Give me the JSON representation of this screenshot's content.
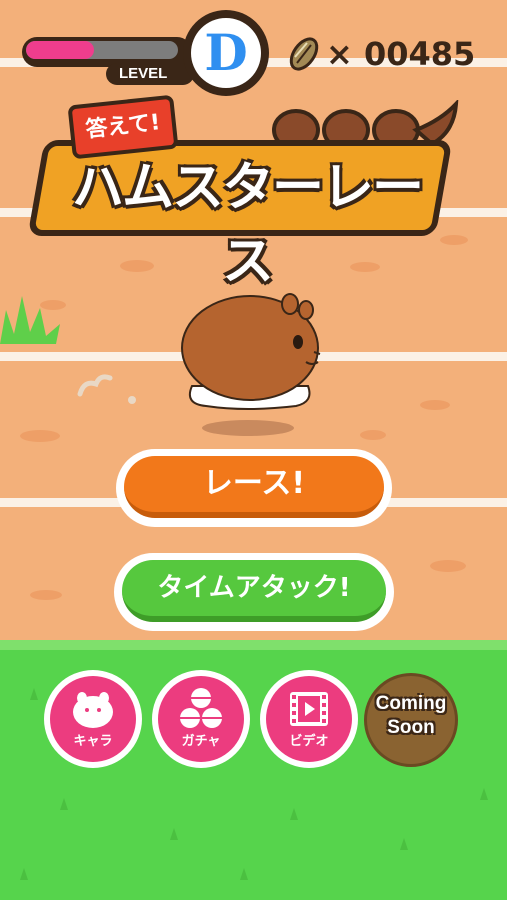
{
  "hud": {
    "level_label": "LEVEL",
    "level_grade": "D",
    "level_progress": 0.45,
    "coin_count": "× 00485",
    "coin_icon": "sunflower-seed-icon"
  },
  "logo": {
    "tag_text": "答えて!",
    "title_text": "ハムスターレース"
  },
  "buttons": {
    "race_label": "レース!",
    "time_attack_label": "タイムアタック!"
  },
  "menu": {
    "chara_label": "キャラ",
    "gacha_label": "ガチャ",
    "video_label": "ビデオ",
    "coming_soon_label": "Coming Soon"
  },
  "colors": {
    "track": "#f3b07a",
    "grass": "#56d44c",
    "race_button": "#f2781a",
    "time_attack_button": "#56c83e",
    "menu_button": "#ec3c7f",
    "level_badge": "#2f8ff0"
  }
}
